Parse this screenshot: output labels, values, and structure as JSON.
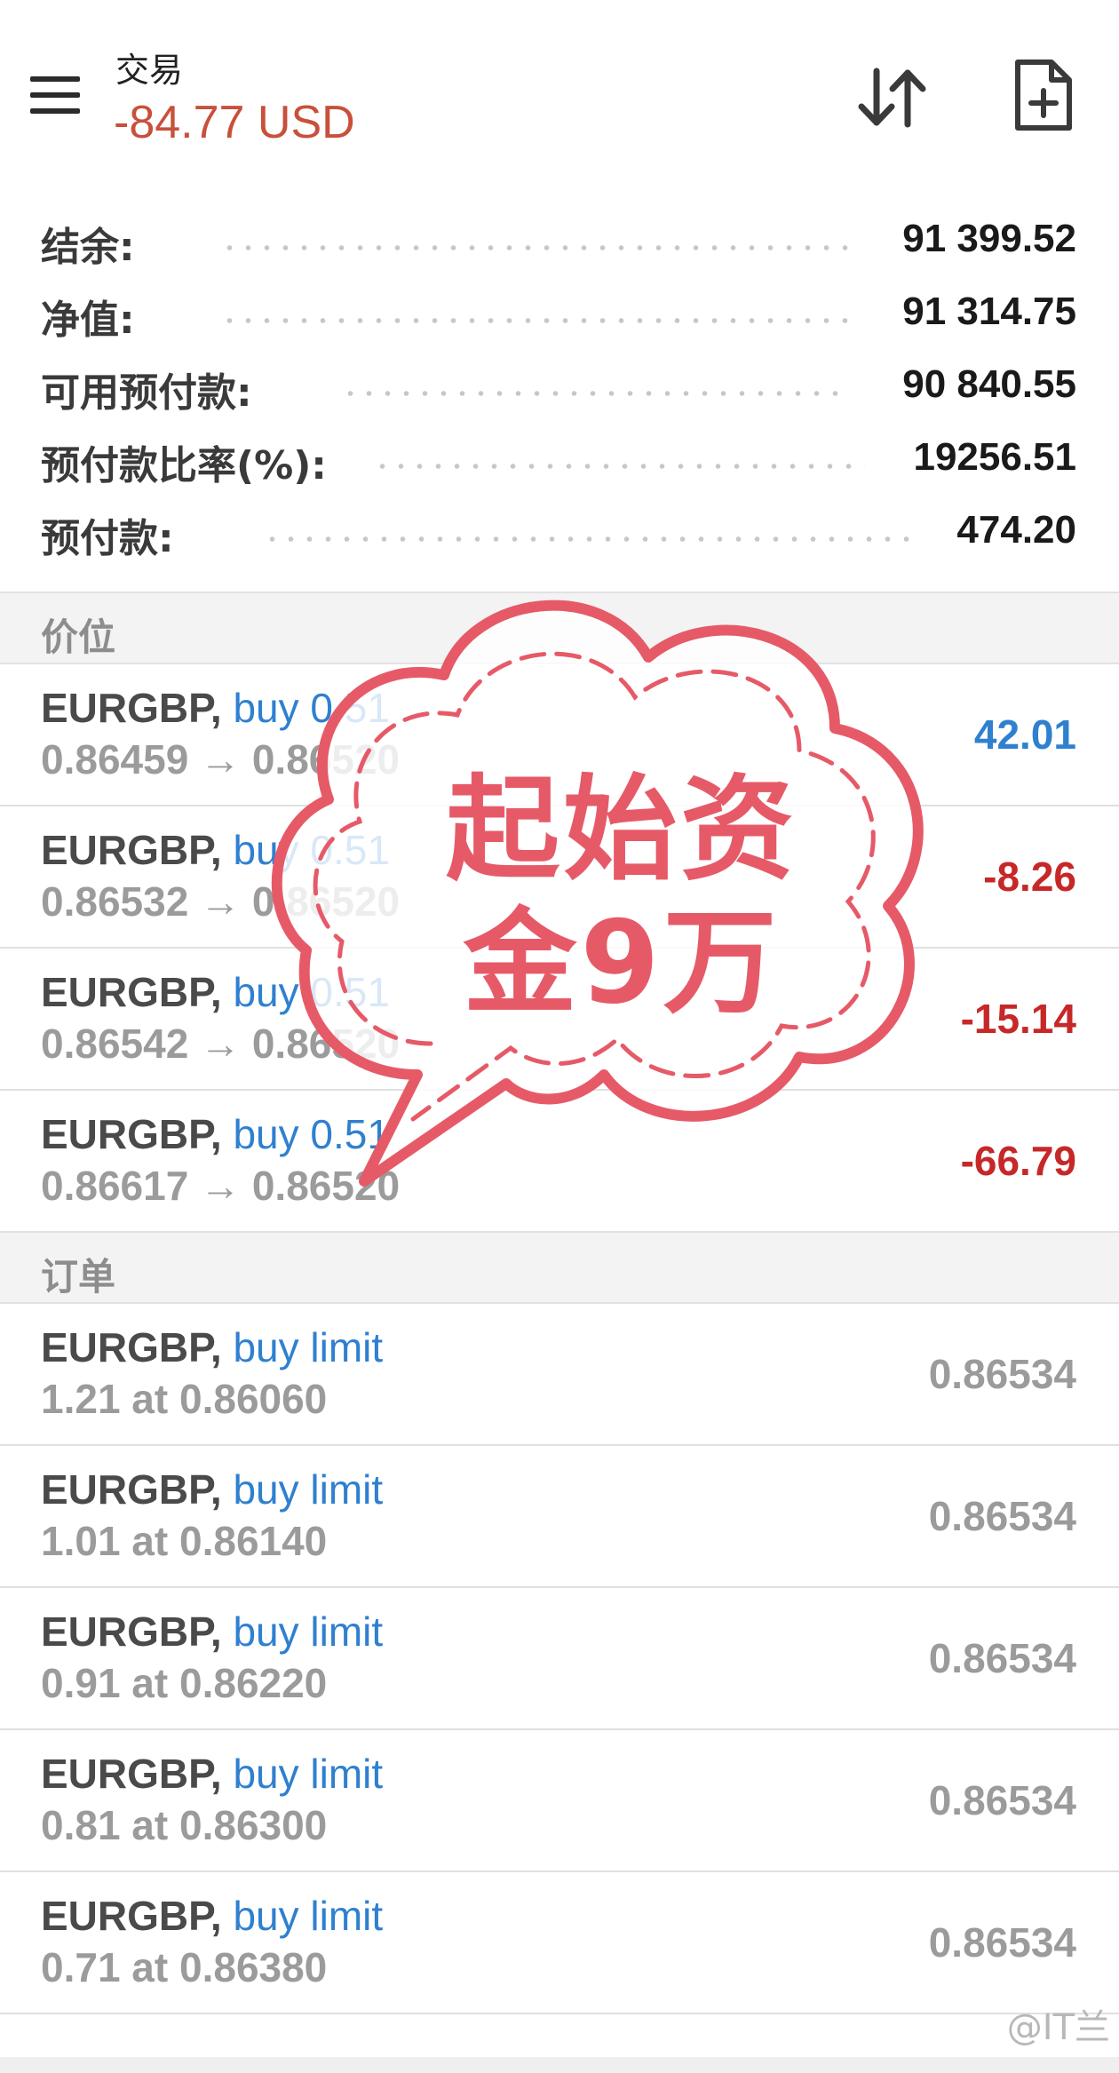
{
  "header": {
    "title": "交易",
    "profit": "-84.77 USD"
  },
  "summary": [
    {
      "label": "结余:",
      "value": "91 399.52"
    },
    {
      "label": "净值:",
      "value": "91 314.75"
    },
    {
      "label": "可用预付款:",
      "value": "90 840.55"
    },
    {
      "label": "预付款比率(%):",
      "value": "19256.51"
    },
    {
      "label": "预付款:",
      "value": "474.20"
    }
  ],
  "positions_section": {
    "title": "价位",
    "items": [
      {
        "symbol": "EURGBP,",
        "type": "buy 0.51",
        "prices": "0.86459 → 0.86520",
        "profit": "42.01"
      },
      {
        "symbol": "EURGBP,",
        "type": "buy 0.51",
        "prices": "0.86532 → 0.86520",
        "profit": "-8.26"
      },
      {
        "symbol": "EURGBP,",
        "type": "buy 0.51",
        "prices": "0.86542 → 0.86520",
        "profit": "-15.14"
      },
      {
        "symbol": "EURGBP,",
        "type": "buy 0.51",
        "prices": "0.86617 → 0.86520",
        "profit": "-66.79"
      }
    ]
  },
  "orders_section": {
    "title": "订单",
    "items": [
      {
        "symbol": "EURGBP,",
        "type": "buy limit",
        "detail": "1.21 at 0.86060",
        "price": "0.86534"
      },
      {
        "symbol": "EURGBP,",
        "type": "buy limit",
        "detail": "1.01 at 0.86140",
        "price": "0.86534"
      },
      {
        "symbol": "EURGBP,",
        "type": "buy limit",
        "detail": "0.91 at 0.86220",
        "price": "0.86534"
      },
      {
        "symbol": "EURGBP,",
        "type": "buy limit",
        "detail": "0.81 at 0.86300",
        "price": "0.86534"
      },
      {
        "symbol": "EURGBP,",
        "type": "buy limit",
        "detail": "0.71 at 0.86380",
        "price": "0.86534"
      }
    ]
  },
  "sticker": {
    "line1": "起始资",
    "line2": "金9万",
    "color": "#e65a68"
  },
  "footer": {
    "watermark": "@IT兰"
  },
  "colors": {
    "profit_header": "#c8503a",
    "positive": "#2f80cf",
    "negative": "#c62828",
    "buy_type": "#2f80cf"
  },
  "icons": {
    "menu": "hamburger-menu-icon",
    "sort": "sort-arrows-icon",
    "new_order": "new-document-plus-icon"
  }
}
